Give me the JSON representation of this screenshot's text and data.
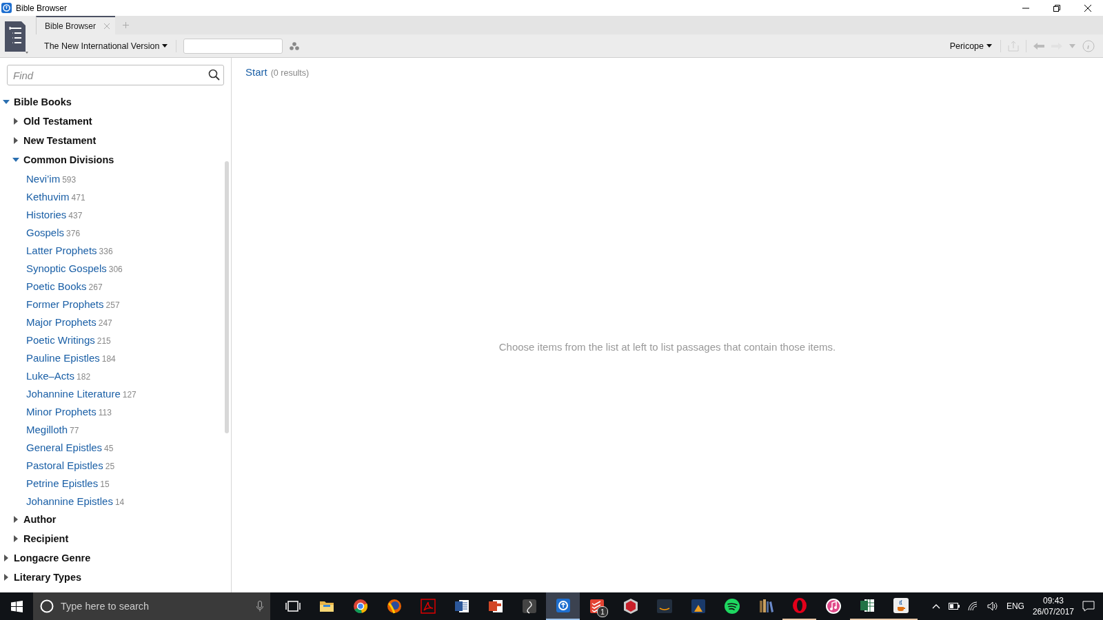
{
  "window": {
    "title": "Bible Browser"
  },
  "tabs": [
    {
      "label": "Bible Browser",
      "selected": true
    }
  ],
  "toolbar": {
    "version": "The New International Version",
    "view": "Pericope"
  },
  "find": {
    "placeholder": "Find"
  },
  "tree": [
    {
      "label": "Bible Books",
      "expanded": true,
      "children": [
        {
          "label": "Old Testament",
          "expanded": false
        },
        {
          "label": "New Testament",
          "expanded": false
        },
        {
          "label": "Common Divisions",
          "expanded": true,
          "children": [
            {
              "label": "Nevi’im",
              "count": "593"
            },
            {
              "label": "Kethuvim",
              "count": "471"
            },
            {
              "label": "Histories",
              "count": "437"
            },
            {
              "label": "Gospels",
              "count": "376"
            },
            {
              "label": "Latter Prophets",
              "count": "336"
            },
            {
              "label": "Synoptic Gospels",
              "count": "306"
            },
            {
              "label": "Poetic Books",
              "count": "267"
            },
            {
              "label": "Former Prophets",
              "count": "257"
            },
            {
              "label": "Major Prophets",
              "count": "247"
            },
            {
              "label": "Poetic Writings",
              "count": "215"
            },
            {
              "label": "Pauline Epistles",
              "count": "184"
            },
            {
              "label": "Luke–Acts",
              "count": "182"
            },
            {
              "label": "Johannine Literature",
              "count": "127"
            },
            {
              "label": "Minor Prophets",
              "count": "113"
            },
            {
              "label": "Megilloth",
              "count": "77"
            },
            {
              "label": "General Epistles",
              "count": "45"
            },
            {
              "label": "Pastoral Epistles",
              "count": "25"
            },
            {
              "label": "Petrine Epistles",
              "count": "15"
            },
            {
              "label": "Johannine Epistles",
              "count": "14"
            }
          ]
        },
        {
          "label": "Author",
          "expanded": false
        },
        {
          "label": "Recipient",
          "expanded": false
        }
      ]
    },
    {
      "label": "Longacre Genre",
      "expanded": false
    },
    {
      "label": "Literary Types",
      "expanded": false
    }
  ],
  "results": {
    "title": "Start",
    "count": "(0 results)",
    "message": "Choose items from the list at left to list passages that contain those items."
  },
  "taskbar": {
    "search_placeholder": "Type here to search",
    "apps": [
      {
        "kind": "taskview",
        "running": false,
        "active": false
      },
      {
        "kind": "folder",
        "running": false,
        "active": false
      },
      {
        "kind": "chrome",
        "running": false,
        "active": false
      },
      {
        "kind": "firefox",
        "running": false,
        "active": false
      },
      {
        "kind": "pdf",
        "running": false,
        "active": false
      },
      {
        "kind": "word",
        "running": false,
        "active": false
      },
      {
        "kind": "slides",
        "running": false,
        "active": false
      },
      {
        "kind": "grey",
        "running": false,
        "active": false
      },
      {
        "kind": "bible",
        "running": true,
        "active": true
      },
      {
        "kind": "todo",
        "running": false,
        "active": false,
        "badge": "1"
      },
      {
        "kind": "red",
        "running": false,
        "active": false
      },
      {
        "kind": "music",
        "running": false,
        "active": false
      },
      {
        "kind": "reader",
        "running": false,
        "active": false
      },
      {
        "kind": "spotify",
        "running": false,
        "active": false
      },
      {
        "kind": "books",
        "running": false,
        "active": false
      },
      {
        "kind": "opera",
        "running": true,
        "active": false
      },
      {
        "kind": "itunes",
        "running": false,
        "active": false
      },
      {
        "kind": "excel",
        "running": true,
        "active": false
      },
      {
        "kind": "java",
        "running": true,
        "active": false
      }
    ],
    "language": "ENG",
    "time": "09:43",
    "date": "26/07/2017"
  }
}
